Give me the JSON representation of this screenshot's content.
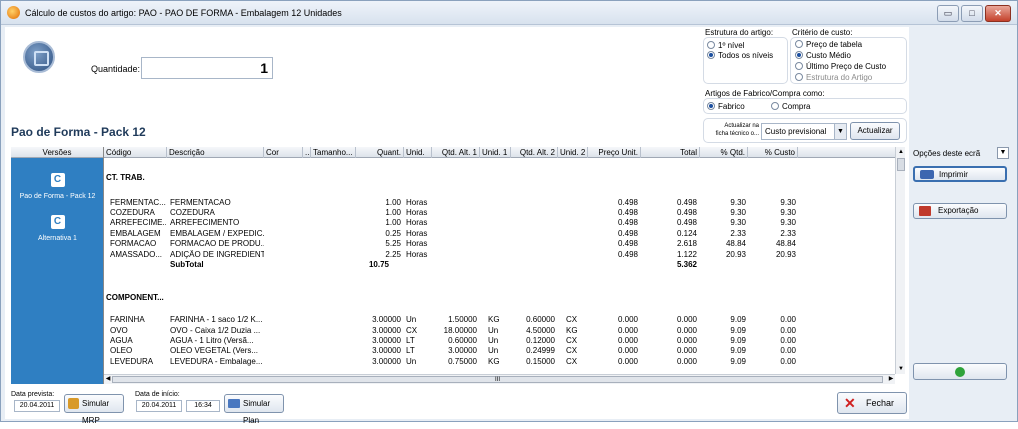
{
  "window": {
    "title": "Cálculo de custos do artigo: PAO - PAO DE FORMA - Embalagem 12 Unidades",
    "min": "▭",
    "max": "□",
    "close": "✕"
  },
  "quantity": {
    "label": "Quantidade:",
    "value": "1"
  },
  "estrutura": {
    "title": "Estrutura do artigo:",
    "options": [
      {
        "label": "1º nível",
        "selected": false
      },
      {
        "label": "Todos os níveis",
        "selected": true
      }
    ]
  },
  "criterio": {
    "title": "Critério de custo:",
    "options": [
      {
        "label": "Preço de tabela",
        "selected": false
      },
      {
        "label": "Custo Médio",
        "selected": true
      },
      {
        "label": "Último Preço de Custo",
        "selected": false
      },
      {
        "label": "Estrutura do Artigo",
        "selected": false,
        "disabled": true
      }
    ]
  },
  "fabrico": {
    "title": "Artigos de Fabrico/Compra como:",
    "options": [
      {
        "label": "Fabrico",
        "selected": true
      },
      {
        "label": "Compra",
        "selected": false
      }
    ]
  },
  "update": {
    "label_line1": "Actualizar na",
    "label_line2": "ficha técnico o...",
    "combo_value": "Custo previsional",
    "button": "Actualizar"
  },
  "section_title": "Pao de Forma - Pack 12",
  "versions": {
    "header": "Versões",
    "items": [
      {
        "label": "Pao de Forma - Pack 12"
      },
      {
        "label": "Alternativa 1"
      }
    ]
  },
  "grid": {
    "columns": [
      "Código",
      "Descrição",
      "Cor",
      "...",
      "Tamanho...",
      "Quant.",
      "Unid.",
      "Qtd. Alt. 1",
      "Unid. 1",
      "Qtd. Alt. 2",
      "Unid. 2",
      "Preço Unit.",
      "Total",
      "% Qtd.",
      "% Custo"
    ],
    "groups": [
      {
        "title": "CT. TRAB.",
        "rows": [
          {
            "code": "FERMENTAC...",
            "desc": "FERMENTACAO",
            "qty": "1.00",
            "unit": "Horas",
            "q1": "",
            "u1": "",
            "q2": "",
            "u2": "",
            "price": "0.498",
            "total": "0.498",
            "pq": "9.30",
            "pc": "9.30"
          },
          {
            "code": "COZEDURA",
            "desc": "COZEDURA",
            "qty": "1.00",
            "unit": "Horas",
            "q1": "",
            "u1": "",
            "q2": "",
            "u2": "",
            "price": "0.498",
            "total": "0.498",
            "pq": "9.30",
            "pc": "9.30"
          },
          {
            "code": "ARREFECIME...",
            "desc": "ARREFECIMENTO",
            "qty": "1.00",
            "unit": "Horas",
            "q1": "",
            "u1": "",
            "q2": "",
            "u2": "",
            "price": "0.498",
            "total": "0.498",
            "pq": "9.30",
            "pc": "9.30"
          },
          {
            "code": "EMBALAGEM",
            "desc": "EMBALAGEM / EXPEDIC...",
            "qty": "0.25",
            "unit": "Horas",
            "q1": "",
            "u1": "",
            "q2": "",
            "u2": "",
            "price": "0.498",
            "total": "0.124",
            "pq": "2.33",
            "pc": "2.33"
          },
          {
            "code": "FORMACAO",
            "desc": "FORMACAO DE PRODU...",
            "qty": "5.25",
            "unit": "Horas",
            "q1": "",
            "u1": "",
            "q2": "",
            "u2": "",
            "price": "0.498",
            "total": "2.618",
            "pq": "48.84",
            "pc": "48.84"
          },
          {
            "code": "AMASSADO...",
            "desc": "ADIÇÃO DE INGREDIENT...",
            "qty": "2.25",
            "unit": "Horas",
            "q1": "",
            "u1": "",
            "q2": "",
            "u2": "",
            "price": "0.498",
            "total": "1.122",
            "pq": "20.93",
            "pc": "20.93"
          }
        ],
        "subtotal": {
          "label": "SubTotal",
          "qty": "10.75",
          "total": "5.362"
        }
      },
      {
        "title": "COMPONENT...",
        "rows": [
          {
            "code": "FARINHA",
            "desc": "FARINHA - 1 saco 1/2 K...",
            "qty": "3.00000",
            "unit": "Un",
            "q1": "1.50000",
            "u1": "KG",
            "q2": "0.60000",
            "u2": "CX",
            "price": "0.000",
            "total": "0.000",
            "pq": "9.09",
            "pc": "0.00"
          },
          {
            "code": "OVO",
            "desc": "OVO - Caixa 1/2 Duzia  ...",
            "qty": "3.00000",
            "unit": "CX",
            "q1": "18.00000",
            "u1": "Un",
            "q2": "4.50000",
            "u2": "KG",
            "price": "0.000",
            "total": "0.000",
            "pq": "9.09",
            "pc": "0.00"
          },
          {
            "code": "AGUA",
            "desc": "AGUA - 1 Litro  (Versã...",
            "qty": "3.00000",
            "unit": "LT",
            "q1": "0.60000",
            "u1": "Un",
            "q2": "0.12000",
            "u2": "CX",
            "price": "0.000",
            "total": "0.000",
            "pq": "9.09",
            "pc": "0.00"
          },
          {
            "code": "OLEO",
            "desc": "OLEO VEGETAL   (Vers...",
            "qty": "3.00000",
            "unit": "LT",
            "q1": "3.00000",
            "u1": "Un",
            "q2": "0.24999",
            "u2": "CX",
            "price": "0.000",
            "total": "0.000",
            "pq": "9.09",
            "pc": "0.00"
          },
          {
            "code": "LEVEDURA",
            "desc": "LEVEDURA - Embalage...",
            "qty": "3.00000",
            "unit": "Un",
            "q1": "0.75000",
            "u1": "KG",
            "q2": "0.15000",
            "u2": "CX",
            "price": "0.000",
            "total": "0.000",
            "pq": "9.09",
            "pc": "0.00"
          }
        ]
      }
    ]
  },
  "scroll": {
    "up": "▲",
    "down": "▼",
    "left": "◀",
    "right": "▶",
    "grip": "III"
  },
  "sidebar": {
    "options_label": "Opções deste ecrã",
    "print": "Imprimir",
    "export": "Exportação"
  },
  "bottom": {
    "data_prevista_label": "Data prevista:",
    "data_prevista": "20.04.2011",
    "simular_mrp": "Simular MRP",
    "data_inicio_label": "Data de início:",
    "data_inicio": "20.04.2011",
    "hora_inicio": "16:34",
    "simular_plan": "Simular Plan",
    "fechar": "Fechar"
  },
  "colors": {
    "accent_blue": "#2f7fc2",
    "title_blue": "#1f3a5a"
  }
}
